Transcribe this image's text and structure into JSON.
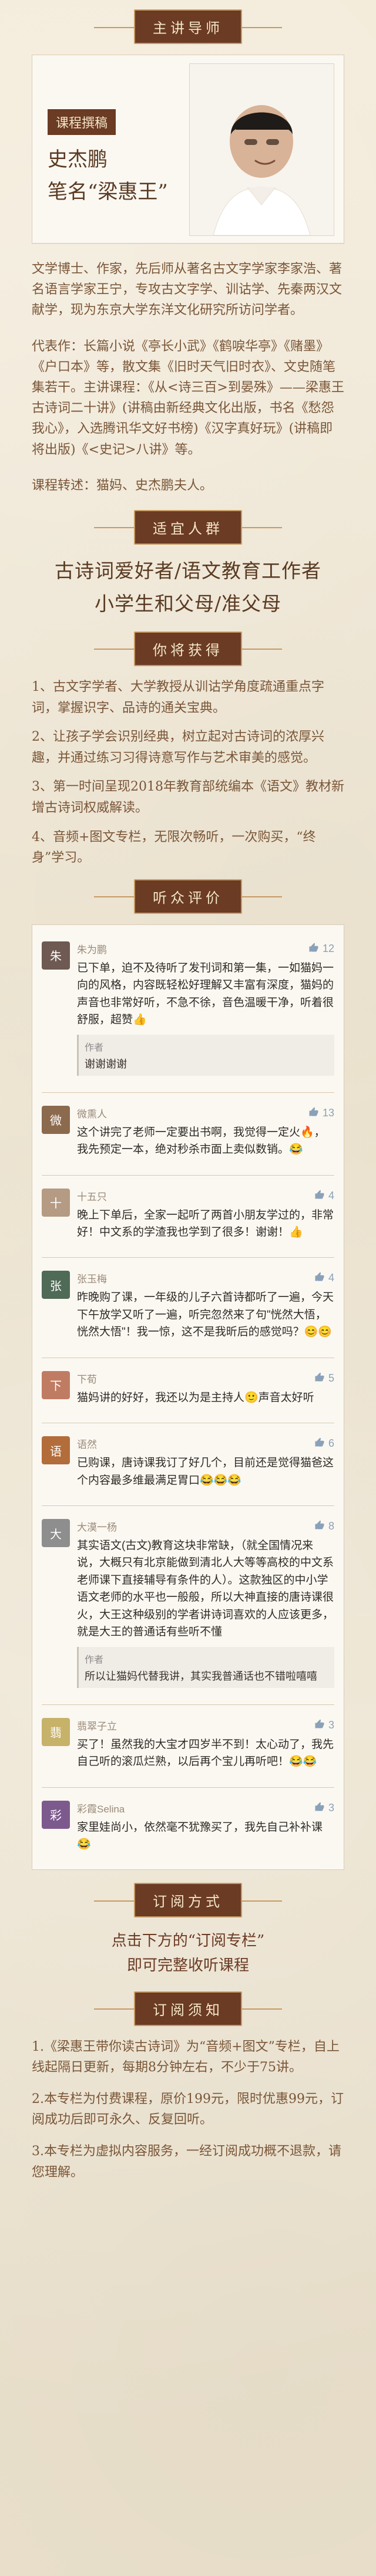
{
  "sections": {
    "teacher_title": "主讲导师",
    "audience_title": "适宜人群",
    "gain_title": "你将获得",
    "reviews_title": "听众评价",
    "subscribe_title": "订阅方式",
    "notice_title": "订阅须知"
  },
  "teacher": {
    "badge": "课程撰稿",
    "name": "史杰鹏",
    "pen_name": "笔名“梁惠王”",
    "bio": "文学博士、作家，先后师从著名古文字学家李家浩、著名语言学家王宁，专攻古文字学、训诂学、先秦两汉文献学，现为东京大学东洋文化研究所访问学者。",
    "works": "代表作：长篇小说《亭长小武》《鹤唳华亭》《赌墨》《户口本》等，散文集《旧时天气旧时衣》、文史随笔集若干。主讲课程：《从<诗三百>到晏殊》——梁惠王古诗词二十讲》(讲稿由新经典文化出版，书名《愁怨我心》，入选腾讯华文好书榜)《汉字真好玩》(讲稿即将出版)《<史记>八讲》等。",
    "thanks": "课程转述：猫妈、史杰鹏夫人。"
  },
  "audience": {
    "line1": "古诗词爱好者/语文教育工作者",
    "line2": "小学生和父母/准父母"
  },
  "gains": [
    "1、古文字学者、大学教授从训诂学角度疏通重点字词，掌握识字、品诗的通关宝典。",
    "2、让孩子学会识别经典，树立起对古诗词的浓厚兴趣，并通过练习习得诗意写作与艺术审美的感觉。",
    "3、第一时间呈现2018年教育部统编本《语文》教材新增古诗词权威解读。",
    "4、音频+图文专栏，无限次畅听，一次购买，“终身”学习。"
  ],
  "reviews": [
    {
      "name": "朱为鹏",
      "likes": "12",
      "text": "已下单，迫不及待听了发刊词和第一集，一如猫妈一向的风格，内容既轻松好理解又丰富有深度，猫妈的声音也非常好听，不急不徐，音色温暖干净，听着很舒服，超赞👍",
      "reply_who": "作者",
      "reply": "谢谢谢谢"
    },
    {
      "name": "微熏人",
      "likes": "13",
      "text": "这个讲完了老师一定要出书啊，我觉得一定火🔥，我先预定一本，绝对秒杀市面上卖似数销。😂"
    },
    {
      "name": "十五只",
      "likes": "4",
      "text": "晚上下单后，全家一起听了两首小朋友学过的，非常好！中文系的学渣我也学到了很多！谢谢！👍"
    },
    {
      "name": "张玉梅",
      "likes": "4",
      "text": "昨晚购了课，一年级的儿子六首诗都听了一遍，今天下午放学又听了一遍，听完忽然来了句\"恍然大悟，恍然大悟\"！我一惊，这不是我昕后的感觉吗？😊😊"
    },
    {
      "name": "下荀",
      "likes": "5",
      "text": "猫妈讲的好好，我还以为是主持人🙂声音太好听"
    },
    {
      "name": "语然",
      "likes": "6",
      "text": "已购课，唐诗课我订了好几个，目前还是觉得猫爸这个内容最多维最满足胃口😂😂😂"
    },
    {
      "name": "大漠一杨",
      "likes": "8",
      "text": "其实语文(古文)教育这块非常缺，（就全国情况来说，大概只有北京能做到清北人大等等高校的中文系老师课下直接辅导有条件的人）。这款独区的中小学语文老师的水平也一般般，所以大神直接的唐诗课很火，大王这种级别的学者讲诗词喜欢的人应该更多，就是大王的普通话有些听不懂",
      "reply_who": "作者",
      "reply": "所以让猫妈代替我讲，其实我普通话也不错啦嘻嘻"
    },
    {
      "name": "翡翠子立",
      "likes": "3",
      "text": "买了！虽然我的大宝才四岁半不到！太心动了，我先自己听的滚瓜烂熟，以后再个宝儿再听吧！😂😂"
    },
    {
      "name": "彩霞Selina",
      "likes": "3",
      "text": "家里娃尚小，依然毫不犹豫买了，我先自己补补课😂"
    }
  ],
  "subscribe": {
    "line1": "点击下方的“订阅专栏”",
    "line2": "即可完整收听课程"
  },
  "notice": [
    "1.《梁惠王带你读古诗词》为“音频+图文”专栏，自上线起隔日更新，每期8分钟左右，不少于75讲。",
    "2.本专栏为付费课程，原价199元，限时优惠99元，订阅成功后即可永久、反复回听。",
    "3.本专栏为虚拟内容服务，一经订阅成功概不退款，请您理解。"
  ],
  "colors": {
    "accent": "#6b3b24",
    "paper": "#f1e7d2",
    "card": "#fbf8f2"
  }
}
